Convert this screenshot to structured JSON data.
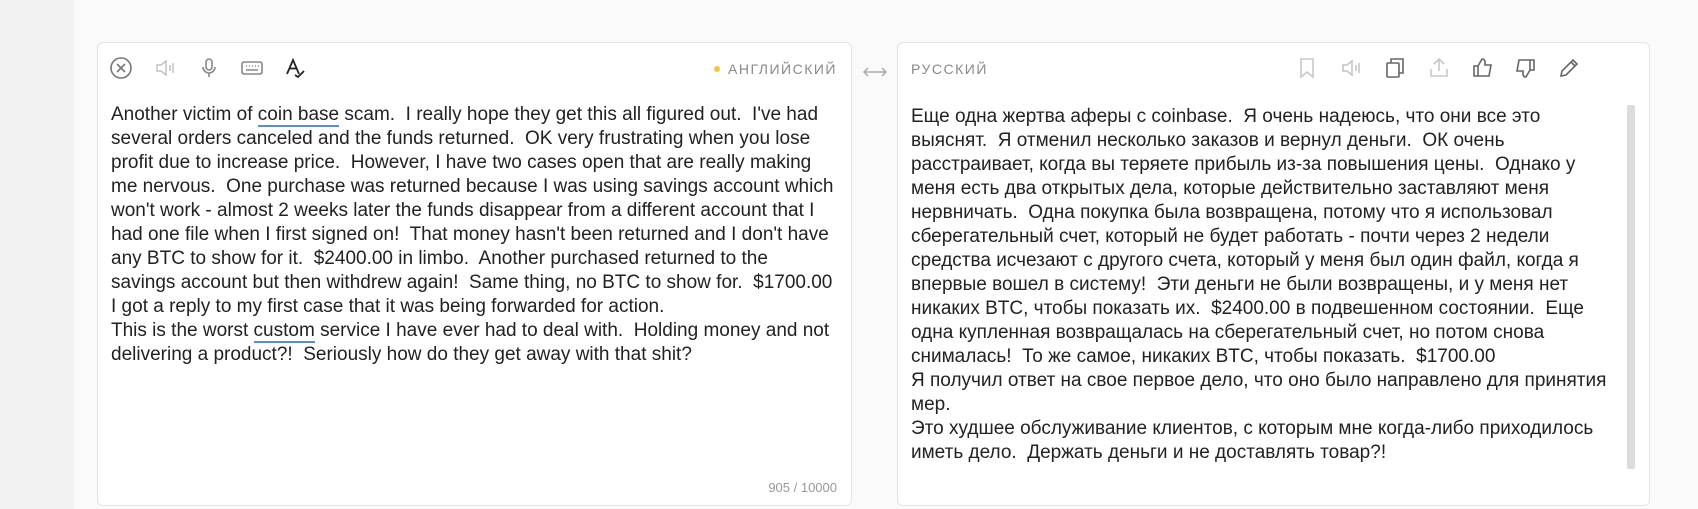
{
  "source": {
    "language": "АНГЛИЙСКИЙ",
    "text_before_link1": "Another victim of ",
    "link1": "coin base",
    "text_mid": " scam.  I really hope they get this all figured out.  I've had several orders canceled and the funds returned.  OK very frustrating when you lose profit due to increase price.  However, I have two cases open that are really making me nervous.  One purchase was returned because I was using savings account which won't work - almost 2 weeks later the funds disappear from a different account that I had one file when I first signed on!  That money hasn't been returned and I don't have any BTC to show for it.  $2400.00 in limbo.  Another purchased returned to the savings account but then withdrew again!  Same thing, no BTC to show for.  $1700.00\nI got a reply to my first case that it was being forwarded for action.\nThis is the worst ",
    "link2": "custom",
    "text_after": " service I have ever had to deal with.  Holding money and not delivering a product?!  Seriously how do they get away with that shit?",
    "char_count": "905 / 10000"
  },
  "target": {
    "language": "РУССКИЙ",
    "text": "Еще одна жертва аферы с coinbase.  Я очень надеюсь, что они все это выяснят.  Я отменил несколько заказов и вернул деньги.  ОК очень расстраивает, когда вы теряете прибыль из-за повышения цены.  Однако у меня есть два открытых дела, которые действительно заставляют меня нервничать.  Одна покупка была возвращена, потому что я использовал сберегательный счет, который не будет работать - почти через 2 недели средства исчезают с другого счета, который у меня был один файл, когда я впервые вошел в систему!  Эти деньги не были возвращены, и у меня нет никаких BTC, чтобы показать их.  $2400.00 в подвешенном состоянии.  Еще одна купленная возвращалась на сберегательный счет, но потом снова снималась!  То же самое, никаких BTC, чтобы показать.  $1700.00\nЯ получил ответ на свое первое дело, что оно было направлено для принятия мер.\nЭто худшее обслуживание клиентов, с которым мне когда-либо приходилось иметь дело.  Держать деньги и не доставлять товар?!"
  },
  "icons": {
    "source_toolbar": [
      "clear-icon",
      "speaker-icon",
      "microphone-icon",
      "keyboard-icon",
      "spellcheck-icon"
    ],
    "target_toolbar": [
      "bookmark-icon",
      "speaker-icon",
      "copy-icon",
      "share-icon",
      "thumbs-up-icon",
      "thumbs-down-icon",
      "edit-icon"
    ]
  },
  "colors": {
    "accent_dot": "#f5c542",
    "underline": "#5b8dd6",
    "icon_gray": "#9a9a9a",
    "icon_dark": "#333333"
  }
}
